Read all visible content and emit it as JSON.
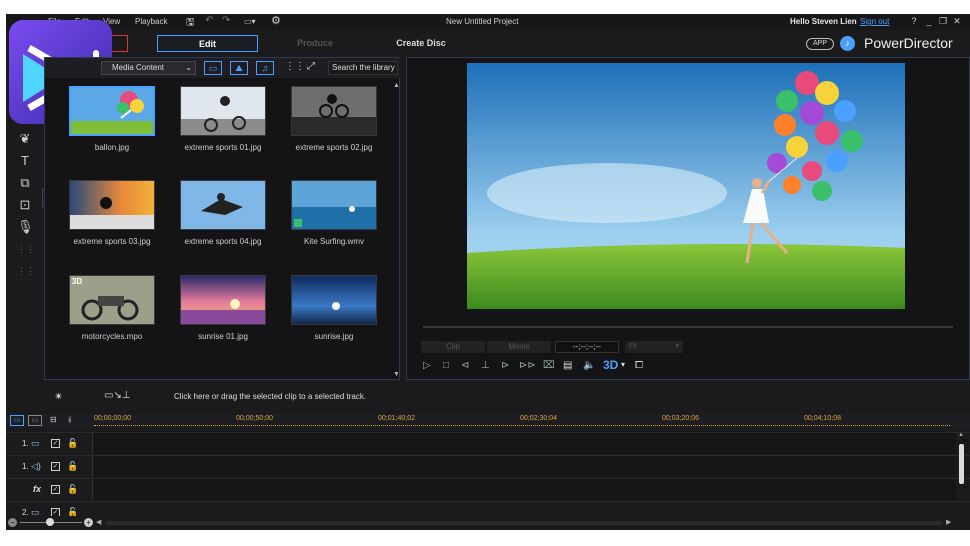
{
  "menu": {
    "file": "File",
    "edit": "Edit",
    "view": "View",
    "playback": "Playback"
  },
  "window": {
    "title": "New Untitled Project",
    "greeting": "Hello Steven Lien",
    "signout": "Sign out",
    "help": "?",
    "minimize": "_",
    "restore": "❐",
    "close": "✕"
  },
  "modes": {
    "edit": "Edit",
    "produce": "Produce",
    "create_disc": "Create Disc"
  },
  "brand": {
    "app_badge": "APP",
    "name": "PowerDirector",
    "accent": "#4aa0ff",
    "logo_color": "#6b3bd6"
  },
  "library": {
    "filter": "Media Content",
    "search_placeholder": "Search the library",
    "items": [
      {
        "name": "ballon.jpg",
        "selected": true
      },
      {
        "name": "extreme sports 01.jpg"
      },
      {
        "name": "extreme sports 02.jpg"
      },
      {
        "name": "extreme sports 03.jpg"
      },
      {
        "name": "extreme sports 04.jpg"
      },
      {
        "name": "Kite Surfing.wmv"
      },
      {
        "name": "motorcycles.mpo",
        "badge": "3D"
      },
      {
        "name": "sunrise 01.jpg"
      },
      {
        "name": "sunrise.jpg"
      }
    ]
  },
  "preview": {
    "clip": "Clip",
    "movie": "Movie",
    "timecode": "--;--;--;--",
    "fit": "Fit",
    "three_d": "3D"
  },
  "hint": "Click here or drag the selected clip to a selected track.",
  "ruler": [
    "00;00;00;00",
    "00;00;50;00",
    "00;01;40;02",
    "00;02;30;04",
    "00;03;20;06",
    "00;04;10;08"
  ],
  "tracks": [
    {
      "label": "1."
    },
    {
      "label": "1."
    },
    {
      "label": "fx"
    },
    {
      "label": "2."
    }
  ]
}
